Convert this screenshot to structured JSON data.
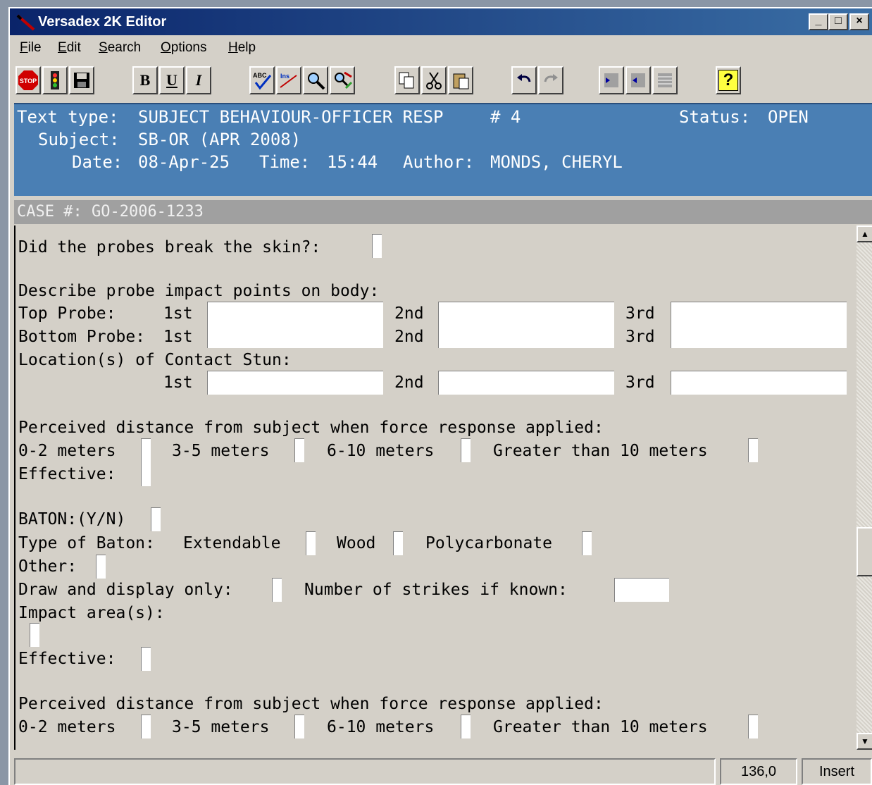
{
  "window": {
    "title": "Versadex 2K Editor",
    "controls": {
      "minimize": "_",
      "maximize": "□",
      "close": "×"
    }
  },
  "menu": [
    {
      "key": "F",
      "rest": "ile"
    },
    {
      "key": "E",
      "rest": "dit"
    },
    {
      "key": "S",
      "rest": "earch"
    },
    {
      "key": "O",
      "rest": "ptions"
    },
    {
      "key": "H",
      "rest": "elp"
    }
  ],
  "toolbar": {
    "stop_label": "STOP",
    "bold": "B",
    "underline": "U",
    "italic": "I",
    "spell_label": "ABC",
    "ins_label": "Ins",
    "help_label": "?"
  },
  "header": {
    "text_type_label": "Text type:",
    "text_type": "SUBJECT BEHAVIOUR-OFFICER RESP",
    "number": "# 4",
    "status_label": "Status:",
    "status": "OPEN",
    "subject_label": "Subject:",
    "subject": "SB-OR (APR 2008)",
    "date_label": "Date:",
    "date": "08-Apr-25",
    "time_label": "Time:",
    "time": "15:44",
    "author_label": "Author:",
    "author": "MONDS, CHERYL"
  },
  "case": {
    "label": "CASE #:",
    "value": "GO-2006-1233"
  },
  "form": {
    "probes_break": "Did the probes break the skin?:",
    "describe_probe": "Describe probe impact points on body:",
    "top_probe": "Top Probe:",
    "bottom_probe": "Bottom Probe:",
    "first": "1st",
    "second": "2nd",
    "third": "3rd",
    "contact_stun": "Location(s) of Contact Stun:",
    "perceived_distance": "Perceived distance from subject when force response applied:",
    "d_0_2": "0-2 meters",
    "d_3_5": "3-5 meters",
    "d_6_10": "6-10 meters",
    "d_gt10": "Greater than 10 meters",
    "effective": "Effective:",
    "baton": "BATON:(Y/N)",
    "type_of_baton": "Type of Baton:",
    "extendable": "Extendable",
    "wood": "Wood",
    "polycarbonate": "Polycarbonate",
    "other": "Other:",
    "draw_display": "Draw and display only:",
    "num_strikes": "Number of strikes if known:",
    "impact_areas": "Impact area(s):"
  },
  "status_bar": {
    "position": "136,0",
    "mode": "Insert"
  }
}
